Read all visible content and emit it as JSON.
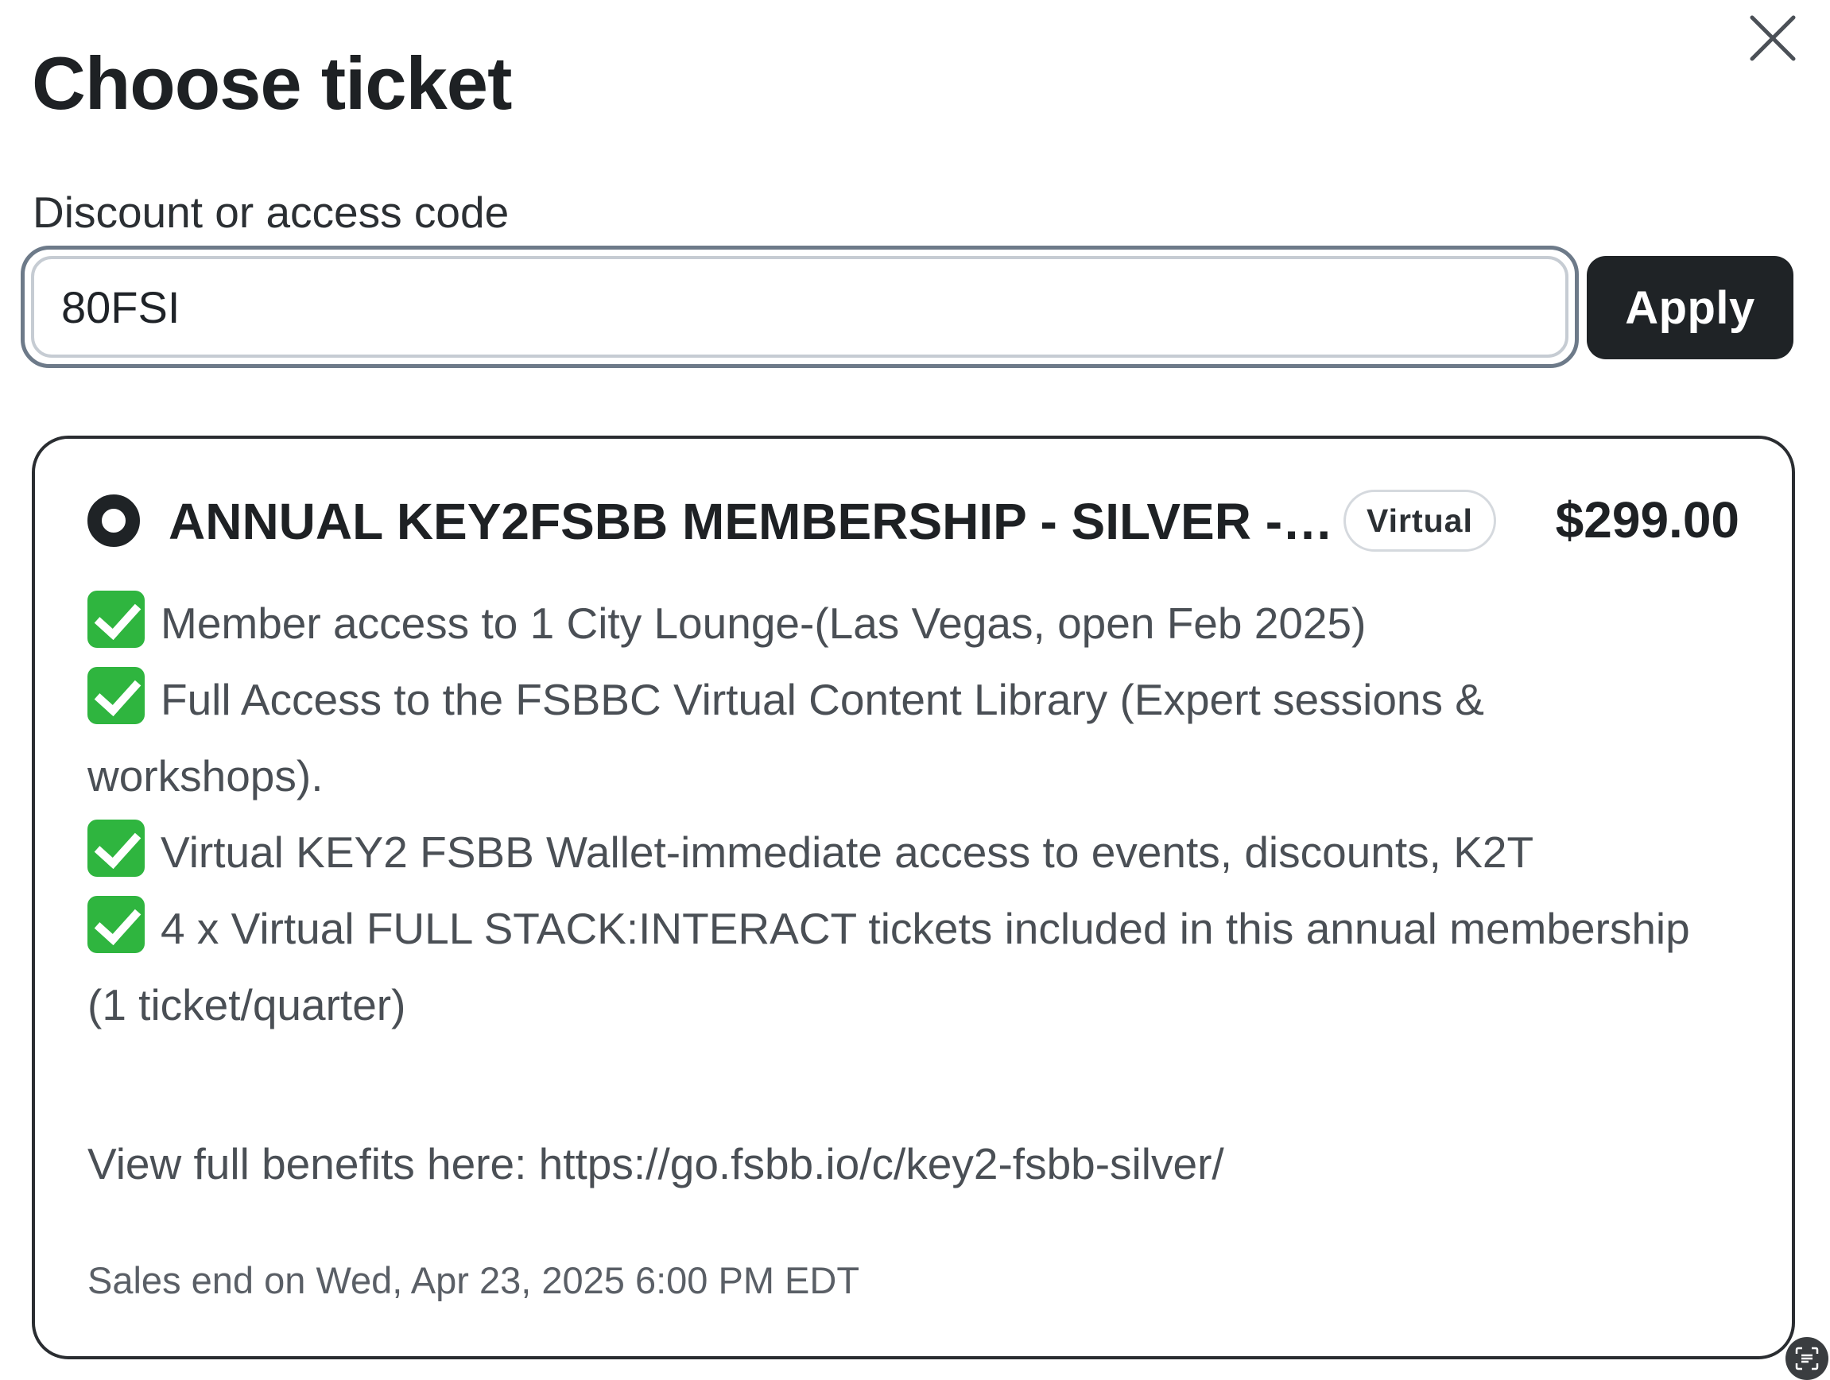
{
  "dialog": {
    "title": "Choose ticket"
  },
  "code": {
    "label": "Discount or access code",
    "value": "80FSI",
    "apply_label": "Apply"
  },
  "ticket": {
    "name": "ANNUAL KEY2FSBB MEMBERSHIP - SILVER - ...",
    "badge": "Virtual",
    "price": "$299.00",
    "benefits": [
      "Member access to 1 City Lounge-(Las Vegas, open Feb 2025)",
      "Full Access to the FSBBC Virtual Content Library (Expert sessions & workshops).",
      "Virtual KEY2 FSBB Wallet-immediate access to events, discounts, K2T",
      "4 x Virtual FULL STACK:INTERACT tickets included in this annual membership (1 ticket/quarter)"
    ],
    "benefits_link": "View full benefits here: https://go.fsbb.io/c/key2-fsbb-silver/",
    "sales_end": "Sales end on Wed, Apr 23, 2025 6:00 PM EDT"
  },
  "icons": {
    "close": "close-icon",
    "radio": "radio-selected-icon",
    "check": "green-checkmark-icon",
    "scan": "scan-text-icon"
  },
  "colors": {
    "primary_button": "#1f2326",
    "check_green": "#2fb53f",
    "focus_ring": "#6d7a89"
  }
}
